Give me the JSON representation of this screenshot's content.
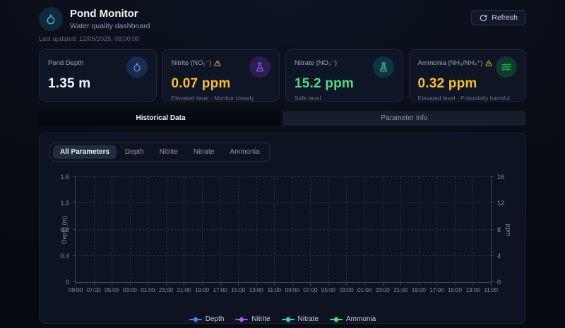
{
  "header": {
    "title": "Pond Monitor",
    "subtitle": "Water quality dashboard",
    "last_updated": "Last updated: 12/05/2025, 09:00:00",
    "refresh_label": "Refresh"
  },
  "cards": [
    {
      "label": "Pond Depth",
      "value": "1.35 m",
      "status": "",
      "warning": false,
      "icon": "droplet-icon",
      "value_color": "#f1f5f9",
      "icon_color": "#60a5fa",
      "icon_bg": "#1b2b4d"
    },
    {
      "label": "Nitrite (NO₂⁻)",
      "value": "0.07 ppm",
      "status": "Elevated level - Monitor closely",
      "warning": true,
      "icon": "flask-icon",
      "value_color": "#fbbf24",
      "icon_color": "#a855f7",
      "icon_bg": "#2c1e4f"
    },
    {
      "label": "Nitrate (NO₃⁻)",
      "value": "15.2 ppm",
      "status": "Safe level",
      "warning": false,
      "icon": "flask-icon",
      "value_color": "#4ade80",
      "icon_color": "#2dd4bf",
      "icon_bg": "#0d3440"
    },
    {
      "label": "Ammonia (NH₃/NH₄⁺)",
      "value": "0.32 ppm",
      "status": "Elevated level - Potentially harmful",
      "warning": true,
      "icon": "waves-icon",
      "value_color": "#fbbf24",
      "icon_color": "#22c55e",
      "icon_bg": "#103a2a"
    }
  ],
  "tabs": [
    {
      "label": "Historical Data",
      "active": true
    },
    {
      "label": "Parameter Info",
      "active": false
    }
  ],
  "chart_panel": {
    "filters": [
      {
        "label": "All Parameters",
        "active": true
      },
      {
        "label": "Depth",
        "active": false
      },
      {
        "label": "Nitrite",
        "active": false
      },
      {
        "label": "Nitrate",
        "active": false
      },
      {
        "label": "Ammonia",
        "active": false
      }
    ]
  },
  "chart_data": {
    "type": "line",
    "title": "",
    "grid": true,
    "legend_position": "bottom",
    "x": {
      "label": "",
      "ticks": [
        "09:00",
        "07:00",
        "05:00",
        "03:00",
        "01:00",
        "23:00",
        "21:00",
        "19:00",
        "17:00",
        "15:00",
        "13:00",
        "11:00",
        "09:00",
        "07:00",
        "05:00",
        "03:00",
        "01:00",
        "23:00",
        "21:00",
        "19:00",
        "17:00",
        "15:00",
        "13:00",
        "11:00"
      ]
    },
    "y_left": {
      "label": "Depth (m)",
      "ticks": [
        "0",
        "0.4",
        "0.8",
        "1.2",
        "1.6"
      ],
      "range": [
        0,
        1.6
      ]
    },
    "y_right": {
      "label": "ppm",
      "ticks": [
        "0",
        "4",
        "8",
        "12",
        "16"
      ],
      "range": [
        0,
        16
      ]
    },
    "series": [
      {
        "name": "Depth",
        "color": "#3b82f6",
        "axis": "left",
        "values": []
      },
      {
        "name": "Nitrite",
        "color": "#a855f7",
        "axis": "right",
        "values": []
      },
      {
        "name": "Nitrate",
        "color": "#2dd4bf",
        "axis": "right",
        "values": []
      },
      {
        "name": "Ammonia",
        "color": "#4ade80",
        "axis": "right",
        "values": []
      }
    ]
  }
}
